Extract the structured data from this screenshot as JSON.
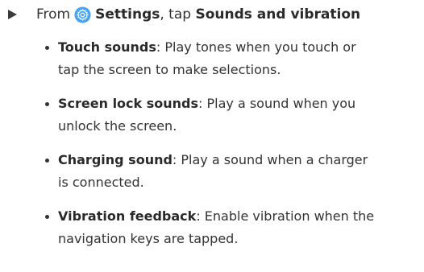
{
  "step": {
    "marker_icon": "triangle-right-icon",
    "prefix": "From",
    "settings_icon": "settings-gear-icon",
    "settings_label": "Settings",
    "middle": ", tap",
    "target": "Sounds and vibration",
    "icon_color": "#4aa3f0"
  },
  "bullets": [
    {
      "term": "Touch sounds",
      "line1": ": Play tones when you touch or",
      "line2": "tap the screen to make selections."
    },
    {
      "term": "Screen lock sounds",
      "line1": ": Play a sound when you",
      "line2": "unlock the screen."
    },
    {
      "term": "Charging sound",
      "line1": ": Play a sound when a charger",
      "line2": "is connected."
    },
    {
      "term": "Vibration feedback",
      "line1": ": Enable vibration when the",
      "line2": "navigation keys are tapped."
    }
  ]
}
